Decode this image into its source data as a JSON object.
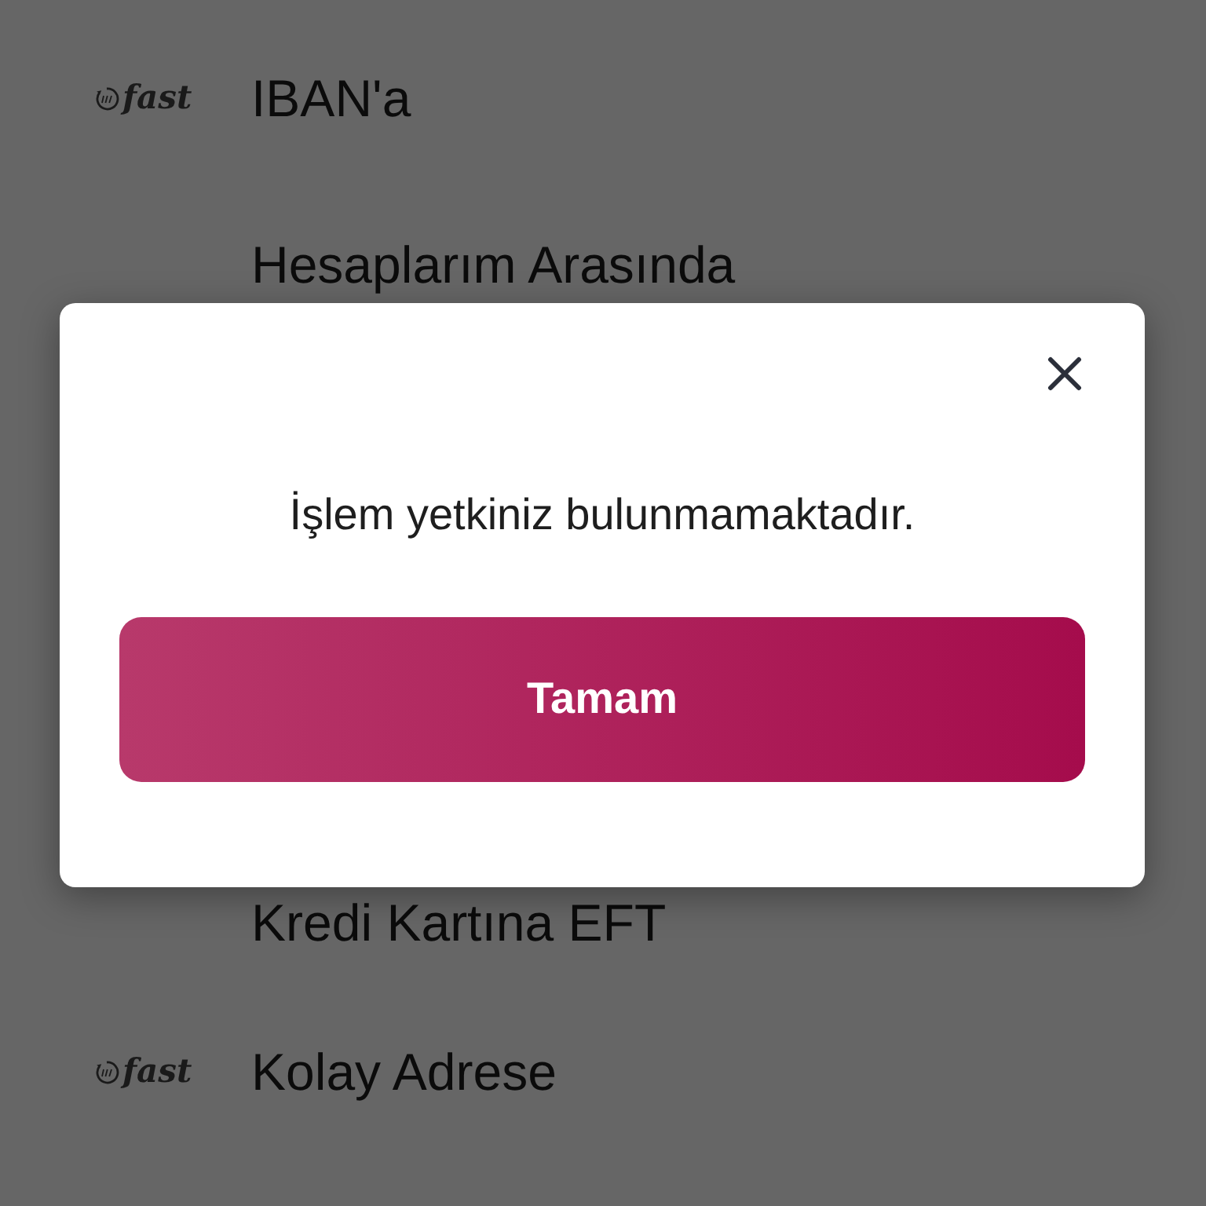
{
  "transfer_list": {
    "items": [
      {
        "label": "IBAN'a",
        "logo_text": "fast"
      },
      {
        "label": "Hesaplarım Arasında"
      },
      {
        "label": "Kredi Kartına EFT"
      },
      {
        "label": "Kolay Adrese",
        "logo_text": "fast"
      }
    ]
  },
  "dialog": {
    "message": "İşlem yetkiniz bulunmamaktadır.",
    "button": "Tamam"
  }
}
